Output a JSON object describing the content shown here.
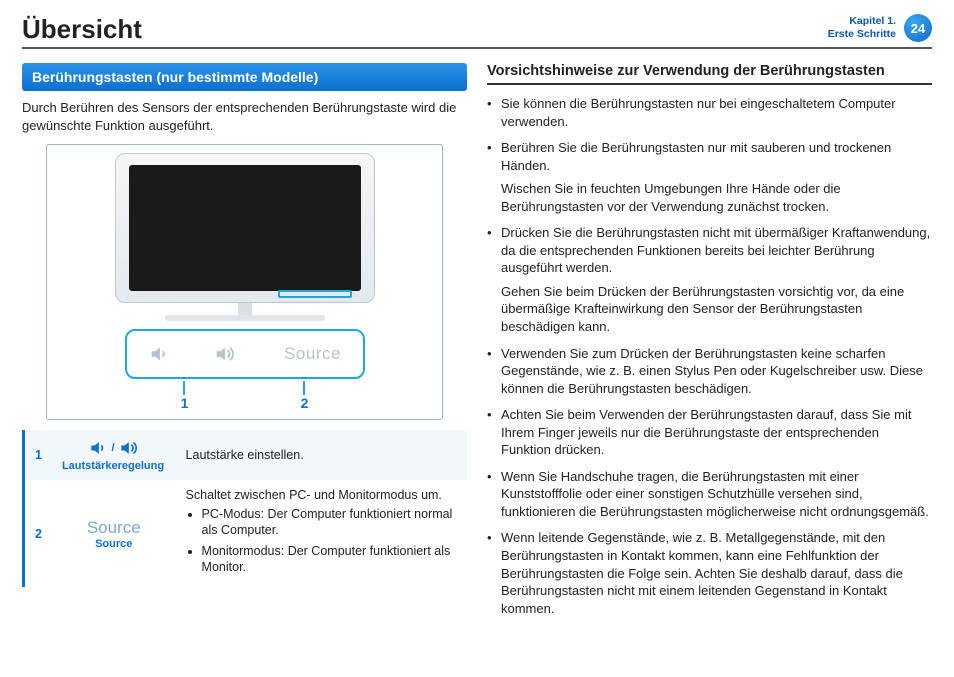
{
  "header": {
    "title": "Übersicht",
    "chapter_line1": "Kapitel 1.",
    "chapter_line2": "Erste Schritte",
    "page_number": "24"
  },
  "left": {
    "section_title": "Berührungstasten (nur bestimmte Modelle)",
    "intro": "Durch Berühren des Sensors der entsprechenden Berührungstaste wird die gewünschte Funktion ausgeführt.",
    "diagram": {
      "label1": "1",
      "label2": "2",
      "source_text": "Source"
    },
    "table": {
      "row1": {
        "num": "1",
        "icon_label": "Lautstärkeregelung",
        "desc": "Lautstärke einstellen."
      },
      "row2": {
        "num": "2",
        "title_big": "Source",
        "title_small": "Source",
        "desc_intro": "Schaltet zwischen PC- und Monitormodus um.",
        "bullet_pc": "PC-Modus: Der Computer funktioniert normal als Computer.",
        "bullet_monitor": "Monitormodus: Der Computer funktioniert als Monitor."
      }
    }
  },
  "right": {
    "heading": "Vorsichtshinweise zur Verwendung der Berührungstasten",
    "items": [
      {
        "text": "Sie können die Berührungstasten nur bei eingeschaltetem Computer verwenden."
      },
      {
        "text": "Berühren Sie die Berührungstasten nur mit sauberen und trockenen Händen.",
        "extra": "Wischen Sie in feuchten Umgebungen Ihre Hände oder die Berührungstasten vor der Verwendung zunächst trocken."
      },
      {
        "text": "Drücken Sie die Berührungstasten nicht mit übermäßiger Kraftanwendung, da die entsprechenden Funktionen bereits bei leichter Berührung ausgeführt werden.",
        "extra": "Gehen Sie beim Drücken der Berührungstasten vorsichtig vor, da eine übermäßige Krafteinwirkung den Sensor der Berührungstasten beschädigen kann."
      },
      {
        "text": "Verwenden Sie zum Drücken der Berührungstasten keine scharfen Gegenstände, wie z. B. einen Stylus Pen oder Kugelschreiber usw. Diese können die Berührungstasten beschädigen."
      },
      {
        "text": "Achten Sie beim Verwenden der Berührungstasten darauf, dass Sie mit Ihrem Finger jeweils nur die Berührungstaste der entsprechenden Funktion drücken."
      },
      {
        "text": "Wenn Sie Handschuhe tragen, die Berührungstasten mit einer Kunststofffolie oder einer sonstigen Schutzhülle versehen sind, funktionieren die Berührungstasten möglicherweise nicht ordnungsgemäß."
      },
      {
        "text": "Wenn leitende Gegenstände, wie z. B. Metallgegenstände, mit den Berührungstasten in Kontakt kommen, kann eine Fehlfunktion der Berührungstasten die Folge sein. Achten Sie deshalb darauf, dass die Berührungstasten nicht mit einem leitenden Gegenstand in Kontakt kommen."
      }
    ]
  }
}
